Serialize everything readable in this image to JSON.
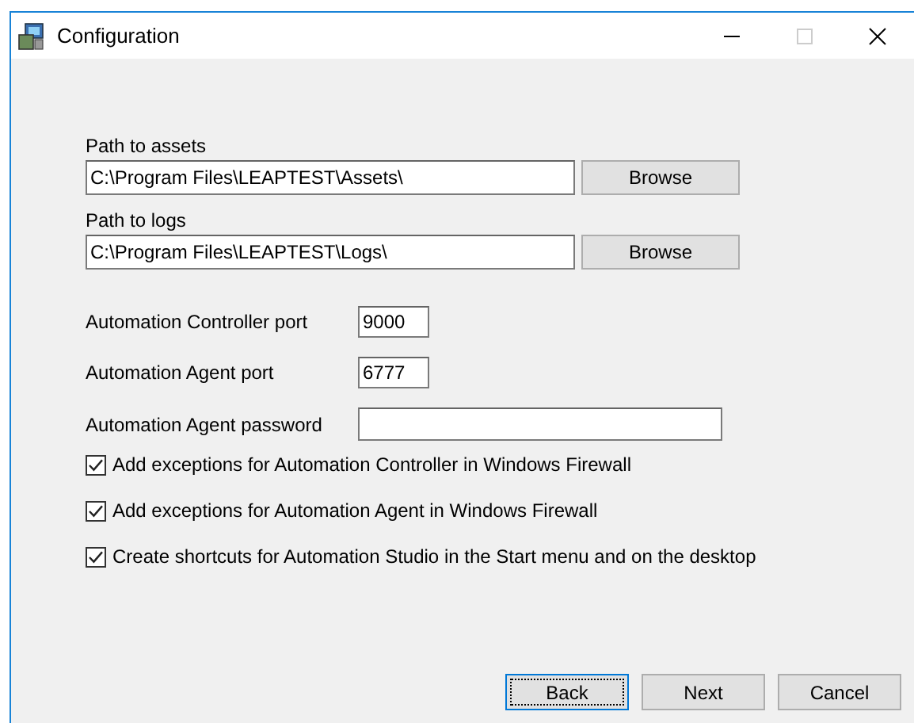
{
  "window": {
    "title": "Configuration"
  },
  "paths": [
    {
      "label": "Path to assets",
      "value": "C:\\Program Files\\LEAPTEST\\Assets\\",
      "button": "Browse"
    },
    {
      "label": "Path to logs",
      "value": "C:\\Program Files\\LEAPTEST\\Logs\\",
      "button": "Browse"
    }
  ],
  "fields": [
    {
      "label": "Automation Controller port",
      "value": "9000",
      "kind": "short"
    },
    {
      "label": "Automation Agent port",
      "value": "6777",
      "kind": "short"
    },
    {
      "label": "Automation Agent password",
      "kind": "wide"
    }
  ],
  "options": [
    {
      "label": "Add exceptions for Automation Controller in Windows Firewall",
      "checked": true
    },
    {
      "label": "Add exceptions for Automation Agent in Windows Firewall",
      "checked": true
    },
    {
      "label": "Create shortcuts for Automation Studio in the Start menu and on the desktop",
      "checked": true
    }
  ],
  "buttons": [
    {
      "label": "Back",
      "focused": true
    },
    {
      "label": "Next",
      "focused": false
    },
    {
      "label": "Cancel",
      "focused": false
    }
  ]
}
